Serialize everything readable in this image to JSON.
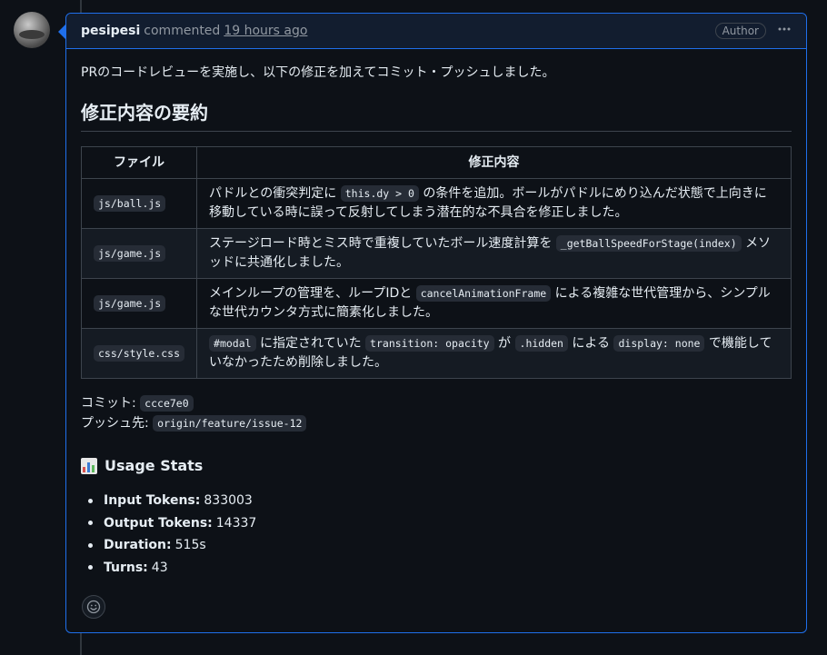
{
  "comment": {
    "author": "pesipesi",
    "action": "commented",
    "time": "19 hours ago",
    "badge": "Author",
    "menu_icon": "kebab-horizontal-icon"
  },
  "body": {
    "intro": "PRのコードレビューを実施し、以下の修正を加えてコミット・プッシュしました。",
    "summary_heading": "修正内容の要約",
    "table": {
      "headers": [
        "ファイル",
        "修正内容"
      ],
      "rows": [
        {
          "file": "js/ball.js",
          "parts": [
            {
              "t": "text",
              "v": "パドルとの衝突判定に "
            },
            {
              "t": "code",
              "v": "this.dy > 0"
            },
            {
              "t": "text",
              "v": " の条件を追加。ボールがパドルにめり込んだ状態で上向きに移動している時に誤って反射してしまう潜在的な不具合を修正しました。"
            }
          ]
        },
        {
          "file": "js/game.js",
          "parts": [
            {
              "t": "text",
              "v": "ステージロード時とミス時で重複していたボール速度計算を "
            },
            {
              "t": "code",
              "v": "_getBallSpeedForStage(index)"
            },
            {
              "t": "text",
              "v": " メソッドに共通化しました。"
            }
          ]
        },
        {
          "file": "js/game.js",
          "parts": [
            {
              "t": "text",
              "v": "メインループの管理を、ループIDと "
            },
            {
              "t": "code",
              "v": "cancelAnimationFrame"
            },
            {
              "t": "text",
              "v": " による複雑な世代管理から、シンプルな世代カウンタ方式に簡素化しました。"
            }
          ]
        },
        {
          "file": "css/style.css",
          "parts": [
            {
              "t": "code",
              "v": "#modal"
            },
            {
              "t": "text",
              "v": " に指定されていた "
            },
            {
              "t": "code",
              "v": "transition: opacity"
            },
            {
              "t": "text",
              "v": " が "
            },
            {
              "t": "code",
              "v": ".hidden"
            },
            {
              "t": "text",
              "v": " による "
            },
            {
              "t": "code",
              "v": "display: none"
            },
            {
              "t": "text",
              "v": " で機能していなかったため削除しました。"
            }
          ]
        }
      ]
    },
    "commit_label": "コミット:",
    "commit_value": "ccce7e0",
    "push_label": "プッシュ先:",
    "push_value": "origin/feature/issue-12",
    "stats_heading": "Usage Stats",
    "stats_icon": "bar-chart-icon",
    "stats": [
      {
        "label": "Input Tokens:",
        "value": "833003"
      },
      {
        "label": "Output Tokens:",
        "value": "14337"
      },
      {
        "label": "Duration:",
        "value": "515s"
      },
      {
        "label": "Turns:",
        "value": "43"
      }
    ]
  },
  "reaction_icon": "smiley-icon",
  "colors": {
    "accent_border": "#1f6feb",
    "header_bg": "#121d2f",
    "background": "#0d1117",
    "text": "#e6edf3",
    "muted": "#9198a1"
  }
}
